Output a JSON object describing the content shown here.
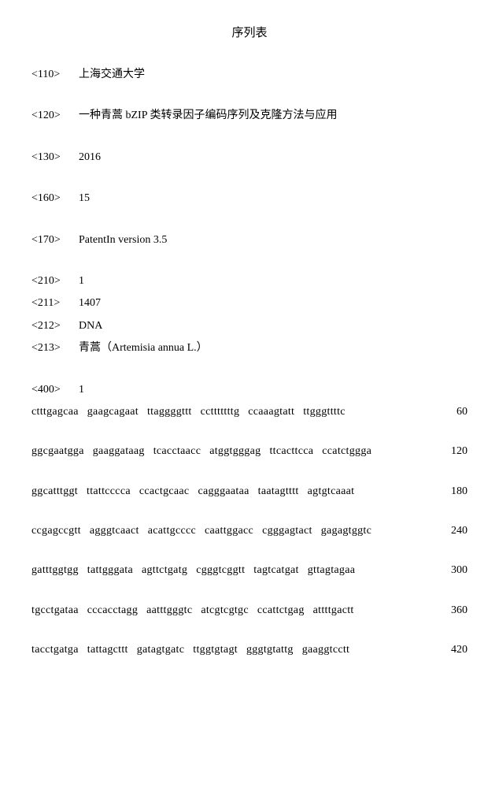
{
  "title": "序列表",
  "entries": [
    {
      "tag": "<110>",
      "value": "上海交通大学",
      "spaced": true
    },
    {
      "tag": "<120>",
      "value": "一种青蒿 bZIP 类转录因子编码序列及克隆方法与应用",
      "spaced": true
    },
    {
      "tag": "<130>",
      "value": "2016",
      "spaced": true
    },
    {
      "tag": "<160>",
      "value": "15",
      "spaced": true
    },
    {
      "tag": "<170>",
      "value": "PatentIn version 3.5",
      "spaced": true,
      "latin": true
    },
    {
      "tag": "<210>",
      "value": "1",
      "spaced": false
    },
    {
      "tag": "<211>",
      "value": "1407",
      "spaced": false
    },
    {
      "tag": "<212>",
      "value": "DNA",
      "spaced": false,
      "latin": true
    },
    {
      "tag": "<213>",
      "value": "青蒿（Artemisia annua L.）",
      "spaced": true
    },
    {
      "tag": "<400>",
      "value": "1",
      "spaced": false
    }
  ],
  "sequences": [
    {
      "blocks": [
        "ctttgagcaa",
        "gaagcagaat",
        "ttaggggttt",
        "cctttttttg",
        "ccaaagtatt",
        "ttgggttttc"
      ],
      "pos": "60"
    },
    {
      "blocks": [
        "ggcgaatgga",
        "gaaggataag",
        "tcacctaacc",
        "atggtgggag",
        "ttcacttcca",
        "ccatctggga"
      ],
      "pos": "120"
    },
    {
      "blocks": [
        "ggcatttggt",
        "ttattcccca",
        "ccactgcaac",
        "cagggaataa",
        "taatagtttt",
        "agtgtcaaat"
      ],
      "pos": "180"
    },
    {
      "blocks": [
        "ccgagccgtt",
        "agggtcaact",
        "acattgcccc",
        "caattggacc",
        "cgggagtact",
        "gagagtggtc"
      ],
      "pos": "240"
    },
    {
      "blocks": [
        "gatttggtgg",
        "tattgggata",
        "agttctgatg",
        "cgggtcggtt",
        "tagtcatgat",
        "gttagtagaa"
      ],
      "pos": "300"
    },
    {
      "blocks": [
        "tgcctgataa",
        "cccacctagg",
        "aatttgggtc",
        "atcgtcgtgc",
        "ccattctgag",
        "attttgactt"
      ],
      "pos": "360"
    },
    {
      "blocks": [
        "tacctgatga",
        "tattagcttt",
        "gatagtgatc",
        "ttggtgtagt",
        "gggtgtattg",
        "gaaggtcctt"
      ],
      "pos": "420"
    }
  ]
}
